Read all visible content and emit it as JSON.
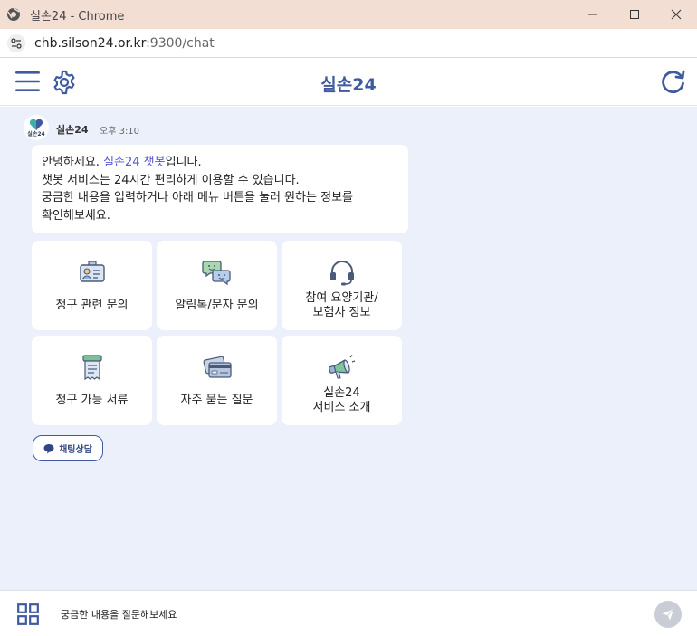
{
  "window": {
    "title": "실손24 - Chrome",
    "controls": [
      "minimize",
      "maximize",
      "close"
    ]
  },
  "address_bar": {
    "url_host": "chb.silson24.or.kr",
    "url_rest": ":9300/chat"
  },
  "header": {
    "title": "실손24",
    "icons": {
      "menu": "hamburger-menu-icon",
      "settings": "gear-icon",
      "refresh": "refresh-icon"
    }
  },
  "message": {
    "avatar_text": "실손24",
    "sender": "실손24",
    "time": "오후 3:10",
    "line1_prefix": "안녕하세요. ",
    "line1_highlight": "실손24 챗봇",
    "line1_suffix": "입니다.",
    "line2": "챗봇 서비스는 24시간 편리하게 이용할 수 있습니다.",
    "line3": "궁금한 내용을 입력하거나 아래 메뉴 버튼을 눌러 원하는 정보를",
    "line4": "확인해보세요."
  },
  "menu_cards": [
    {
      "line1": "청구 관련 문의",
      "line2": "",
      "icon": "id-card-icon"
    },
    {
      "line1": "알림톡/문자 문의",
      "line2": "",
      "icon": "chat-bubbles-icon"
    },
    {
      "line1": "참여 요양기관/",
      "line2": "보험사 정보",
      "icon": "headset-icon"
    },
    {
      "line1": "청구 가능 서류",
      "line2": "",
      "icon": "document-icon"
    },
    {
      "line1": "자주 묻는 질문",
      "line2": "",
      "icon": "credit-card-icon"
    },
    {
      "line1": "실손24",
      "line2": "서비스 소개",
      "icon": "megaphone-icon"
    }
  ],
  "chat_button": {
    "label": "채팅상담",
    "icon": "chat-icon"
  },
  "input": {
    "placeholder": "궁금한 내용을 질문해보세요"
  },
  "colors": {
    "brand": "#3f5a9e",
    "highlight": "#5a55d6",
    "chat_bg": "#ecf0fa",
    "titlebar": "#f3ded4"
  }
}
